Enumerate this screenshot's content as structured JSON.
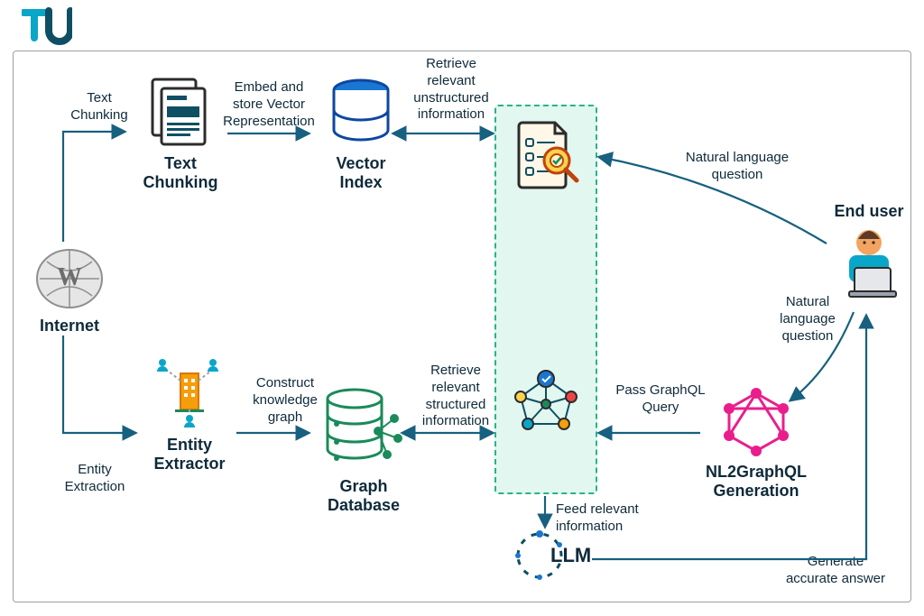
{
  "logo_letters": "TU",
  "nodes": {
    "internet": "Internet",
    "text_chunking": "Text\nChunking",
    "vector_index": "Vector\nIndex",
    "entity_extractor": "Entity\nExtractor",
    "graph_db": "Graph\nDatabase",
    "nl2graphql": "NL2GraphQL\nGeneration",
    "llm": "LLM",
    "end_user": "End user"
  },
  "edges": {
    "text_chunking": "Text\nChunking",
    "embed_store": "Embed and\nstore Vector\nRepresentation",
    "retrieve_unstructured": "Retrieve\nrelevant\nunstructured\ninformation",
    "entity_extraction": "Entity\nExtraction",
    "construct_kg": "Construct\nknowledge\ngraph",
    "retrieve_structured": "Retrieve\nrelevant\nstructured\ninformation",
    "nl_question_top": "Natural language\nquestion",
    "nl_question_side": "Natural\nlanguage\nquestion",
    "pass_graphql": "Pass GraphQL\nQuery",
    "feed_relevant": "Feed relevant\ninformation",
    "generate_answer": "Generate\naccurate answer"
  },
  "colors": {
    "arrow": "#17607f",
    "accent_cyan": "#0aa6c9",
    "accent_green": "#1b8a5a",
    "accent_blue": "#1976d2",
    "accent_pink": "#e91e8c",
    "zone_bg": "#e2f7ef",
    "zone_border": "#27b48a"
  },
  "icon_names": {
    "internet": "globe-wikipedia-icon",
    "documents": "documents-stack-icon",
    "vector_db": "vector-database-icon",
    "entity": "people-nodes-building-icon",
    "graph_db": "graph-database-icon",
    "doc_search": "document-search-magnifier-icon",
    "knowledge_graph": "knowledge-graph-nodes-icon",
    "graphql": "graphql-logo-icon",
    "llm": "llm-circuit-icon",
    "user": "end-user-laptop-icon",
    "logo": "tu-brand-logo"
  }
}
